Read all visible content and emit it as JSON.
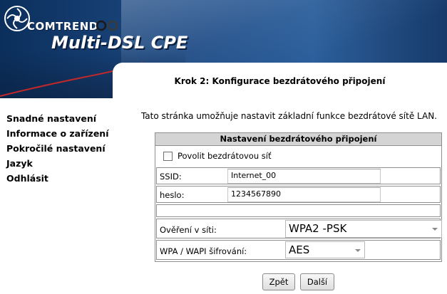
{
  "header": {
    "brand": "COMTREND",
    "product": "Multi-DSL CPE"
  },
  "sidebar": {
    "items": [
      {
        "label": "Snadné nastavení"
      },
      {
        "label": "Informace o zařízení"
      },
      {
        "label": "Pokročilé nastavení"
      },
      {
        "label": "Jazyk"
      },
      {
        "label": "Odhlásit"
      }
    ]
  },
  "main": {
    "step_title": "Krok 2: Konfigurace bezdrátového připojení",
    "description": "Tato stránka umožňuje nastavit základní funkce bezdrátové sítě LAN.",
    "table_header": "Nastavení bezdrátového připojení",
    "enable_wireless": {
      "label": "Povolit bezdrátovou síť",
      "checked": false
    },
    "ssid": {
      "label": "SSID:",
      "value": "Internet_00"
    },
    "password": {
      "label": "heslo:",
      "value": "1234567890"
    },
    "auth": {
      "label": "Ověření v síti:",
      "value": "WPA2 -PSK"
    },
    "encryption": {
      "label": "WPA / WAPI šifrování:",
      "value": "AES"
    },
    "buttons": {
      "back": "Zpět",
      "next": "Další"
    }
  },
  "colors": {
    "banner_dark": "#0b2f5c",
    "banner_mid": "#2c5f9b",
    "table_header_bg": "#d4d4d4"
  }
}
